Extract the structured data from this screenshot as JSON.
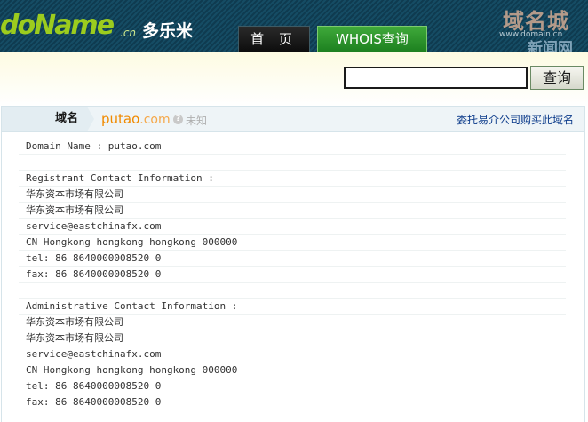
{
  "header": {
    "logo_text": "doName",
    "logo_suffix": ".cn",
    "brand": "多乐米",
    "nav": [
      {
        "label": "首 页",
        "active": false
      },
      {
        "label": "WHOIS查询",
        "active": true
      }
    ],
    "watermark": {
      "title": "域名城",
      "url": "www.domain.cn",
      "subtitle": "新闻网"
    }
  },
  "search": {
    "value": "",
    "button_label": "查询"
  },
  "result": {
    "label": "域名",
    "domain_name": "putao",
    "domain_tld": ".com",
    "status": "未知",
    "buy_link": "委托易介公司购买此域名",
    "whois_lines": [
      "Domain Name : putao.com",
      "",
      "Registrant Contact Information :",
      "华东资本市场有限公司",
      "华东资本市场有限公司",
      "service@eastchinafx.com",
      "CN Hongkong hongkong hongkong 000000",
      "tel: 86 8640000008520 0",
      "fax: 86 8640000008520 0",
      "",
      "Administrative Contact Information :",
      "华东资本市场有限公司",
      "华东资本市场有限公司",
      "service@eastchinafx.com",
      "CN Hongkong hongkong hongkong 000000",
      "tel: 86 8640000008520 0",
      "fax: 86 8640000008520 0"
    ]
  },
  "colors": {
    "header_bg": "#154c64",
    "logo_green": "#9ccc1e",
    "nav_active": "#2d9a30",
    "domain_orange": "#f08a00",
    "link_blue": "#0b3a8a"
  }
}
